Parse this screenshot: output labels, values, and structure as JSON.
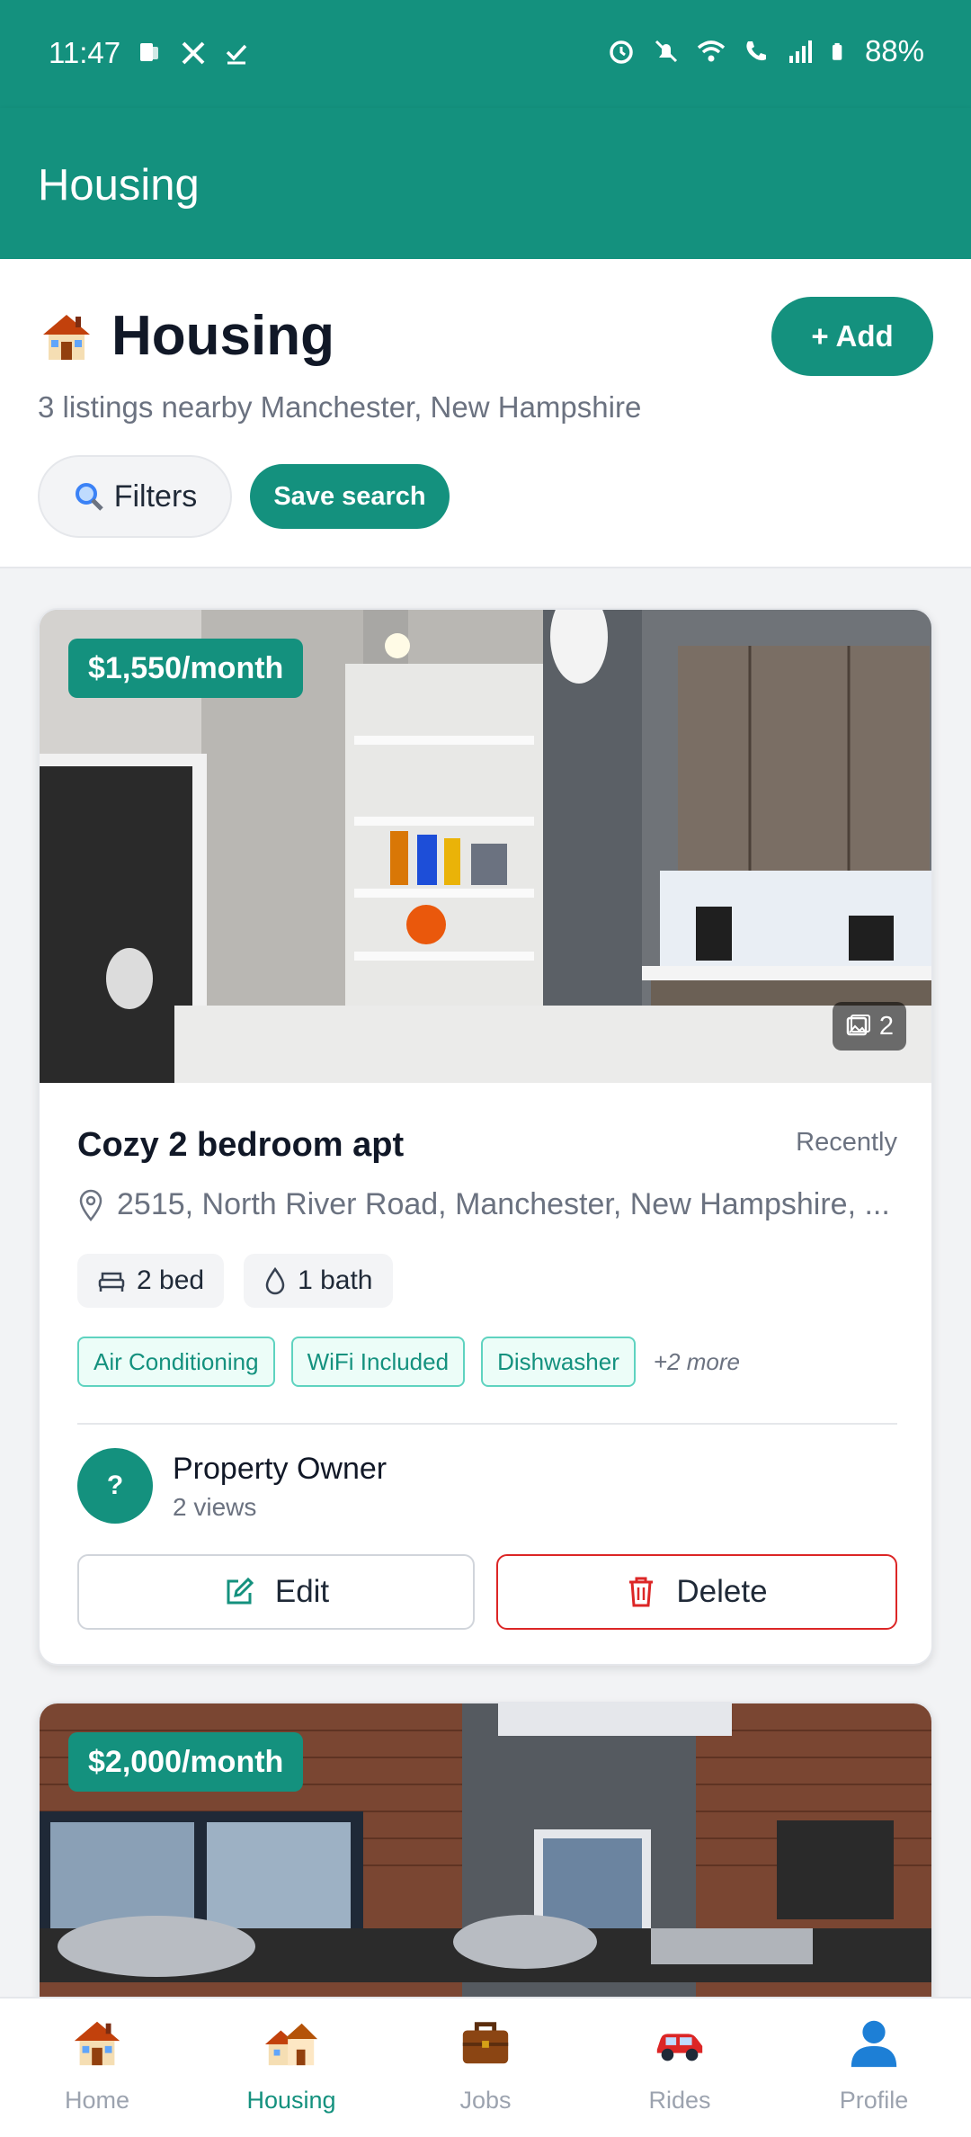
{
  "status_bar": {
    "time": "11:47",
    "battery": "88%"
  },
  "app_bar": {
    "title": "Housing"
  },
  "header": {
    "title": "Housing",
    "subtitle": "3 listings nearby Manchester, New Hampshire",
    "add_label": "+ Add",
    "filters_label": "Filters",
    "save_search_label": "Save search"
  },
  "listings": [
    {
      "price": "$1,550/month",
      "photo_count": "2",
      "title": "Cozy 2 bedroom apt",
      "posted": "Recently",
      "address": "2515, North River Road, Manchester, New Hampshire, ...",
      "beds": "2 bed",
      "baths": "1 bath",
      "amenities": [
        "Air Conditioning",
        "WiFi Included",
        "Dishwasher"
      ],
      "more_amenities": "+2 more",
      "owner_initial": "?",
      "owner_name": "Property Owner",
      "views": "2 views",
      "edit_label": "Edit",
      "delete_label": "Delete"
    },
    {
      "price": "$2,000/month"
    }
  ],
  "bottom_nav": {
    "items": [
      {
        "label": "Home",
        "icon": "home-icon"
      },
      {
        "label": "Housing",
        "icon": "housing-icon",
        "active": true
      },
      {
        "label": "Jobs",
        "icon": "briefcase-icon"
      },
      {
        "label": "Rides",
        "icon": "car-icon"
      },
      {
        "label": "Profile",
        "icon": "profile-icon"
      }
    ]
  },
  "colors": {
    "primary": "#14917e",
    "danger": "#dc2626",
    "muted": "#6b7280"
  }
}
